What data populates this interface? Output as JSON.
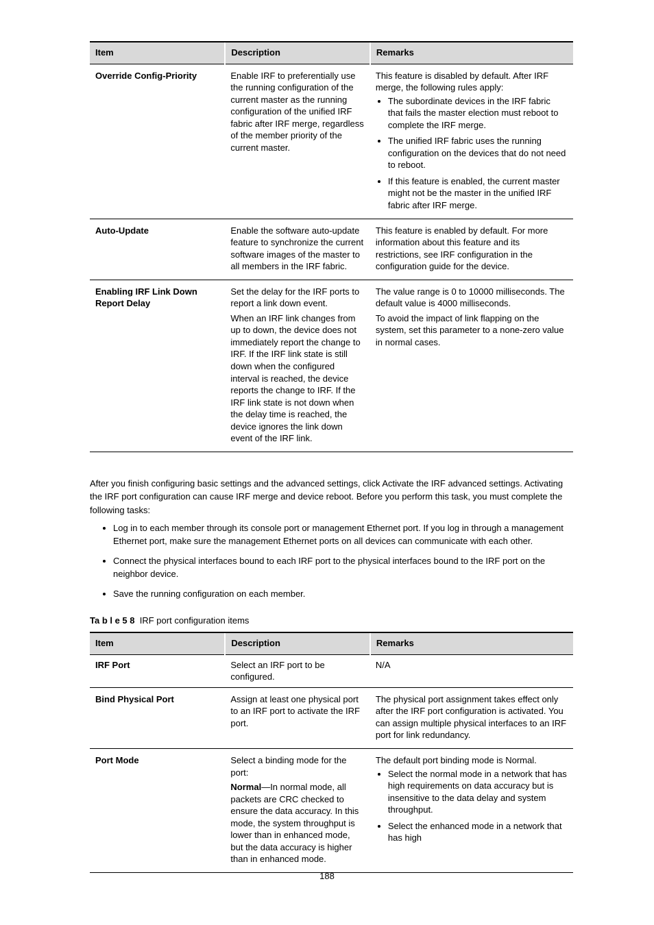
{
  "page_number": "188",
  "table1": {
    "headers": [
      "Item",
      "Descri",
      "Remarks"
    ],
    "header_suffixes": [
      "",
      "ption",
      ""
    ],
    "rows": [
      {
        "item": "Override Config-Priority",
        "desc": "Enable IRF to preferentially use the running configuration of the current master as the running configuration of the unified IRF fabric after IRF merge, regardless of the member priority of the current master.",
        "remarks_pre": "This feature is disabled by default. After IRF merge, the following rules apply:",
        "remarks_list": [
          "The subordinate devices in the IRF fabric that fails the master election must reboot to complete the IRF merge.",
          "The unified IRF fabric uses the running configuration on the devices that do not need to reboot.",
          "If this feature is enabled, the current master might not be the master in the unified IRF fabric after IRF merge."
        ]
      },
      {
        "item": "Auto-Update",
        "desc": "Enable the software auto-update feature to synchronize the current software images of the master to all members in the IRF fabric.",
        "remarks": "This feature is enabled by default. For more information about this feature and its restrictions, see IRF configuration in the configuration guide for the device."
      },
      {
        "item": "Enabling IRF Link Down Report Delay",
        "desc_list": [
          "Set the delay for the IRF ports to report a link down event.",
          "When an IRF link changes from up to down, the device does not immediately report the change to IRF. If the IRF link state is still down when the configured interval is reached, the device reports the change to IRF. If the IRF link state is not down when the delay time is reached, the device ignores the link down event of the IRF link."
        ],
        "remarks_list2": [
          "The value range is 0 to 10000 milliseconds. The default value is 4000 milliseconds.",
          "To avoid the impact of link flapping on the system, set this parameter to a none-zero value in normal cases."
        ]
      }
    ]
  },
  "body": {
    "intro": "After you finish configuring basic settings and the advanced settings, click Activate the IRF advanced settings. Activating the IRF port configuration can cause IRF merge and device reboot. Before you perform this task, you must complete the following tasks:",
    "tasks": [
      "Log in to each member through its console port or management Ethernet port. If you log in through a management Ethernet port, make sure the management Ethernet ports on all devices can communicate with each other.",
      "Connect the physical interfaces bound to each IRF port to the physical interfaces bound to the IRF port on the neighbor device.",
      "Save the running configuration on each member."
    ]
  },
  "table2": {
    "caption_prefix": "Ta b l e  5 8",
    "caption_body": "IRF port configuration items",
    "head_left": "Item",
    "head_left_suffix": "",
    "head_mid": "Descri",
    "head_mid_suffix": "ption",
    "head_right": "Remarks",
    "rows": [
      {
        "item": "IRF Port",
        "desc": "Select an IRF port to be configured.",
        "remarks": "N/A"
      },
      {
        "item": "Bind Physical Port",
        "desc": "Assign at least one physical port to an IRF port to activate the IRF port.",
        "remarks": "The physical port assignment takes effect only after the IRF port configuration is activated. You can assign multiple physical interfaces to an IRF port for link redundancy."
      },
      {
        "item": "Port Mode",
        "desc_lines": [
          "Select a binding mode for the port:",
          "Normal—In normal mode, all packets are CRC checked to ensure the data accuracy. In this mode, the system throughput is lower than in enhanced mode, but the data accuracy is higher than in enhanced mode."
        ],
        "remarks_pre": "The default port binding mode is Normal.",
        "remarks_list": [
          "Select the normal mode in a network that has high requirements on data accuracy but is insensitive to the data delay and system throughput.",
          "Select the enhanced mode in a network that has high"
        ]
      }
    ]
  }
}
